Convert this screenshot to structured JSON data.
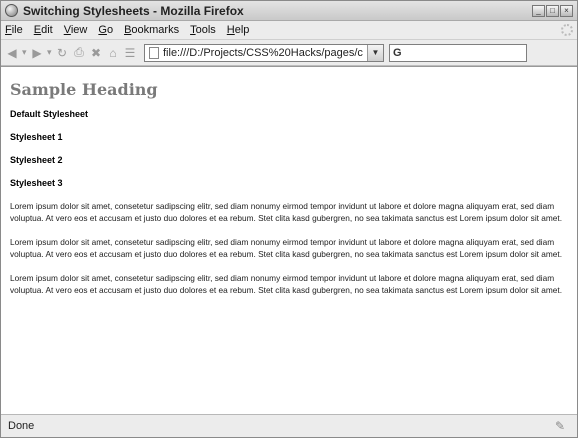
{
  "window": {
    "title": "Switching Stylesheets - Mozilla Firefox"
  },
  "menu": [
    "File",
    "Edit",
    "View",
    "Go",
    "Bookmarks",
    "Tools",
    "Help"
  ],
  "menu_accesskeys": [
    "F",
    "E",
    "V",
    "G",
    "B",
    "T",
    "H"
  ],
  "toolbar": {
    "icons": [
      "back-icon",
      "forward-icon",
      "reload-icon",
      "print-icon",
      "stop-icon",
      "home-icon",
      "bookmark-icon"
    ],
    "url": "file:///D:/Projects/CSS%20Hacks/pages/c",
    "search_engine": "G"
  },
  "page": {
    "heading": "Sample Heading",
    "stylesheet_links": [
      "Default Stylesheet",
      "Stylesheet 1",
      "Stylesheet 2",
      "Stylesheet 3"
    ],
    "paragraphs": [
      "Lorem ipsum dolor sit amet, consetetur sadipscing elitr, sed diam nonumy eirmod tempor invidunt ut labore et dolore magna aliquyam erat, sed diam voluptua. At vero eos et accusam et justo duo dolores et ea rebum. Stet clita kasd gubergren, no sea takimata sanctus est Lorem ipsum dolor sit amet.",
      "Lorem ipsum dolor sit amet, consetetur sadipscing elitr, sed diam nonumy eirmod tempor invidunt ut labore et dolore magna aliquyam erat, sed diam voluptua. At vero eos et accusam et justo duo dolores et ea rebum. Stet clita kasd gubergren, no sea takimata sanctus est Lorem ipsum dolor sit amet.",
      "Lorem ipsum dolor sit amet, consetetur sadipscing elitr, sed diam nonumy eirmod tempor invidunt ut labore et dolore magna aliquyam erat, sed diam voluptua. At vero eos et accusam et justo duo dolores et ea rebum. Stet clita kasd gubergren, no sea takimata sanctus est Lorem ipsum dolor sit amet."
    ]
  },
  "status": {
    "text": "Done"
  }
}
